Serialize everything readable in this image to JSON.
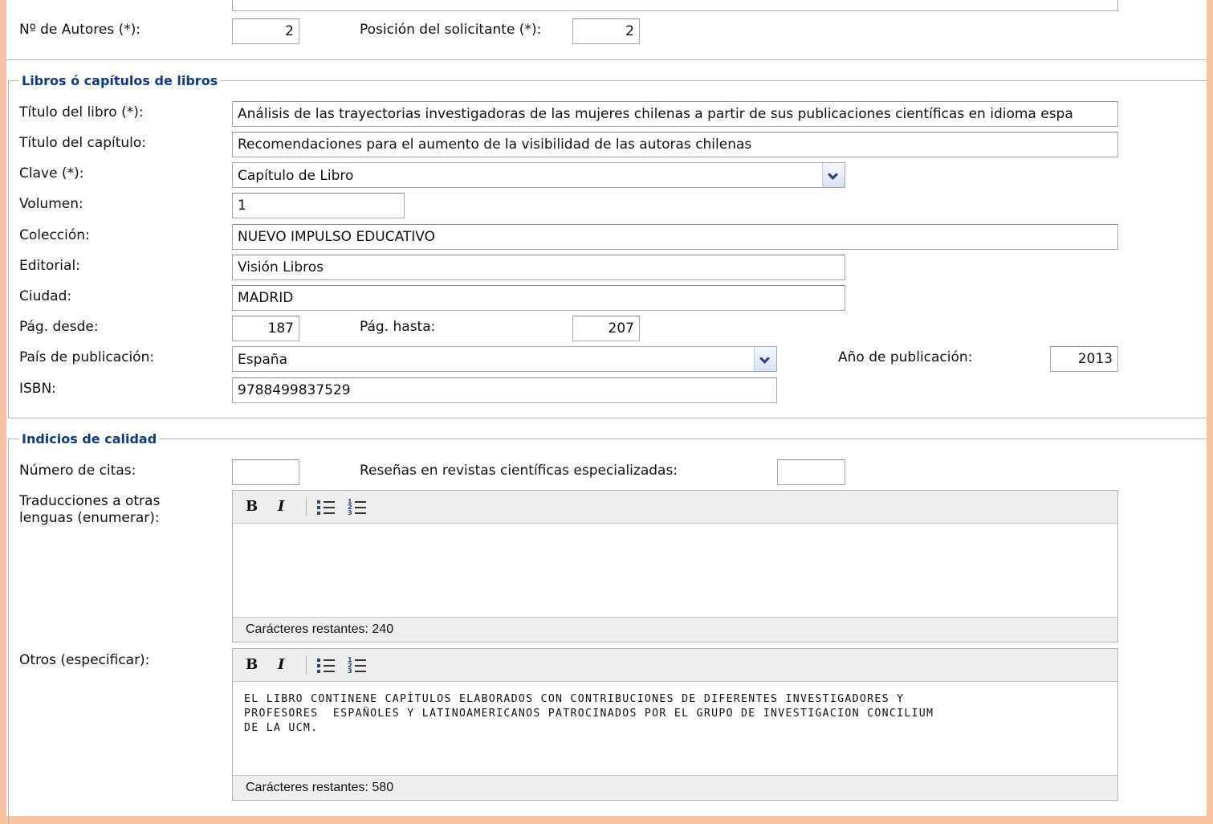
{
  "authors": {
    "count_label": "Nº de Autores (*):",
    "count_value": "2",
    "position_label": "Posición del solicitante (*):",
    "position_value": "2"
  },
  "books_section": {
    "legend": "Libros ó capítulos de libros",
    "book_title_label": "Título del libro (*):",
    "book_title_value": "Análisis de las trayectorias investigadoras de las mujeres chilenas a partir de sus publicaciones científicas en idioma espa",
    "chapter_title_label": "Título del capítulo:",
    "chapter_title_value": "Recomendaciones para el aumento de la visibilidad de las autoras chilenas",
    "key_label": "Clave (*):",
    "key_value": "Capítulo de Libro",
    "volume_label": "Volumen:",
    "volume_value": "1",
    "collection_label": "Colección:",
    "collection_value": "NUEVO IMPULSO EDUCATIVO",
    "publisher_label": "Editorial:",
    "publisher_value": "Visión Libros",
    "city_label": "Ciudad:",
    "city_value": "MADRID",
    "page_from_label": "Pág. desde:",
    "page_from_value": "187",
    "page_to_label": "Pág. hasta:",
    "page_to_value": "207",
    "country_label": "País de publicación:",
    "country_value": "España",
    "year_label": "Año de publicación:",
    "year_value": "2013",
    "isbn_label": "ISBN:",
    "isbn_value": "9788499837529"
  },
  "quality_section": {
    "legend": "Indicios de calidad",
    "citations_label": "Número de citas:",
    "citations_value": "",
    "reviews_label": "Reseñas en revistas científicas especializadas:",
    "reviews_value": "",
    "translations_label_line1": "Traducciones a otras",
    "translations_label_line2": "lenguas (enumerar):",
    "translations_text": "",
    "translations_remaining": "Carácteres restantes: 240",
    "others_label": "Otros (especificar):",
    "others_line1": "EL LIBRO CONTINENE CAPÍTULOS ELABORADOS CON CONTRIBUCIONES DE DIFERENTES INVESTIGADORES Y",
    "others_line2": "PROFESORES  ESPAÑOLES Y LATINOAMERICANOS PATROCINADOS POR EL GRUPO DE INVESTIGACION CONCILIUM",
    "others_line3": "DE LA UCM.",
    "others_remaining": "Carácteres restantes: 580"
  },
  "toolbar": {
    "bold_label": "B",
    "italic_label": "I"
  },
  "icons": {
    "dropdown": "chevron-down-icon",
    "bold": "bold-icon",
    "italic": "italic-icon",
    "bullet_list": "bullet-list-icon",
    "numbered_list": "numbered-list-icon"
  },
  "colors": {
    "background_frame": "#f8c3a0",
    "legend_text": "#0b3a87",
    "toolbar_bg": "#eeeeee"
  }
}
